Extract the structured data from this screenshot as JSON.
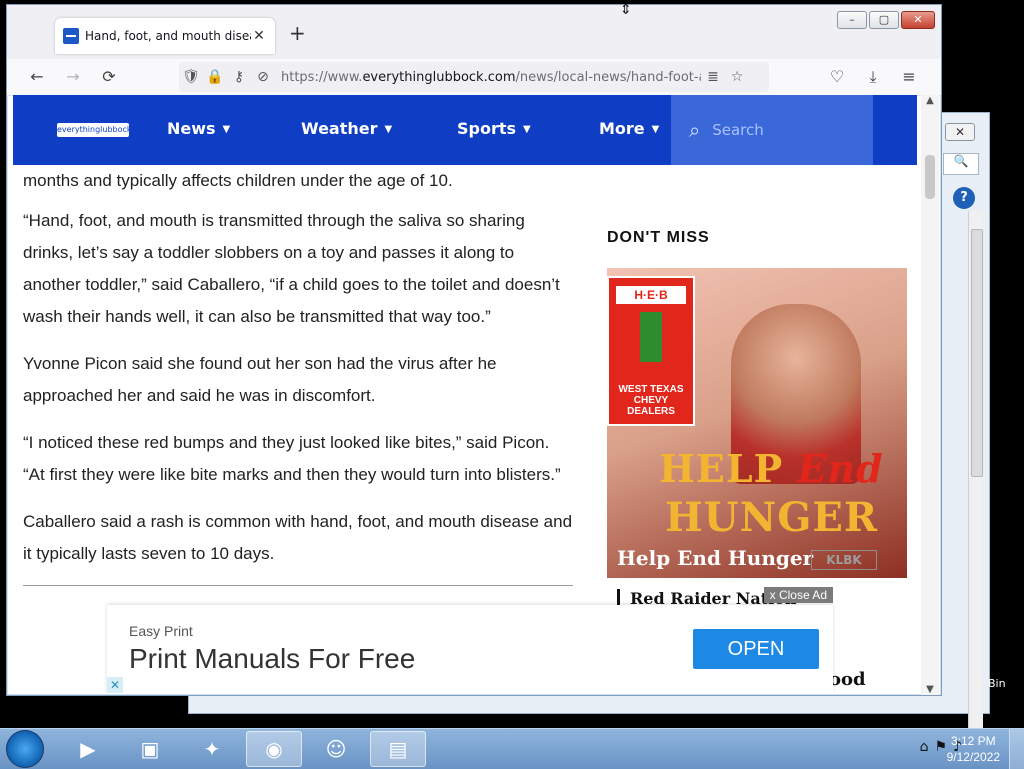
{
  "browser": {
    "tab_title": "Hand, foot, and mouth disease",
    "url_prefix": "https://www.",
    "url_domain": "everythinglubbock.com",
    "url_path": "/news/local-news/hand-foot-and",
    "icons": {
      "back": "←",
      "forward": "→",
      "reload": "⟳",
      "shield": "🛡",
      "lock": "🔒",
      "perm": "⚷",
      "tracking": "⊘",
      "reader": "≣",
      "star": "☆",
      "pocket": "♡",
      "download": "⤓",
      "menu": "≡",
      "new_tab": "+",
      "tab_close": "✕"
    },
    "window_controls": {
      "minimize": "–",
      "maximize": "▢",
      "close": "✕"
    }
  },
  "site": {
    "logo_text": "everythinglubbock",
    "menu": [
      "News",
      "Weather",
      "Sports",
      "More"
    ],
    "search_placeholder": "Search",
    "colors": {
      "header_blue": "#0f3ec4",
      "search_blue": "#3a68d8"
    }
  },
  "article": {
    "paragraphs": [
      "months and typically affects children under the age of 10.",
      "“Hand, foot, and mouth is transmitted through the saliva so sharing drinks, let’s say a toddler slobbers on a toy and passes it along to another toddler,” said Caballero, “if a child goes to the toilet and doesn’t wash their hands well, it can also be transmitted that way too.”",
      "Yvonne Picon said she found out her son had the virus after he approached her and said he was in discomfort.",
      "“I noticed these red bumps and they just looked like bites,” said Picon. “At first they were like bite marks and then they would turn into blisters.”",
      "Caballero said a rash is common with hand, foot, and mouth disease and it typically lasts seven to 10 days."
    ]
  },
  "sidebar": {
    "heading": "DON'T MISS",
    "promo": {
      "heb_logo": "H·E·B",
      "dealers": "WEST TEXAS CHEVY DEALERS",
      "headline_a": "HELP",
      "headline_b": "End",
      "headline_c": "HUNGER",
      "caption": "Help End Hunger",
      "badge": "KLBK"
    },
    "next_item": "Red Raider Nation",
    "tail_text": "ood"
  },
  "ad": {
    "close_label": "x Close Ad",
    "brand": "Easy Print",
    "headline": "Print Manuals For Free",
    "cta": "OPEN"
  },
  "desktop": {
    "recycle_bin_label": "Bin"
  },
  "taskbar": {
    "apps": [
      "media-player",
      "image-viewer",
      "game",
      "firefox",
      "discord",
      "file-explorer"
    ],
    "time": "3:12 PM",
    "date": "9/12/2022"
  }
}
